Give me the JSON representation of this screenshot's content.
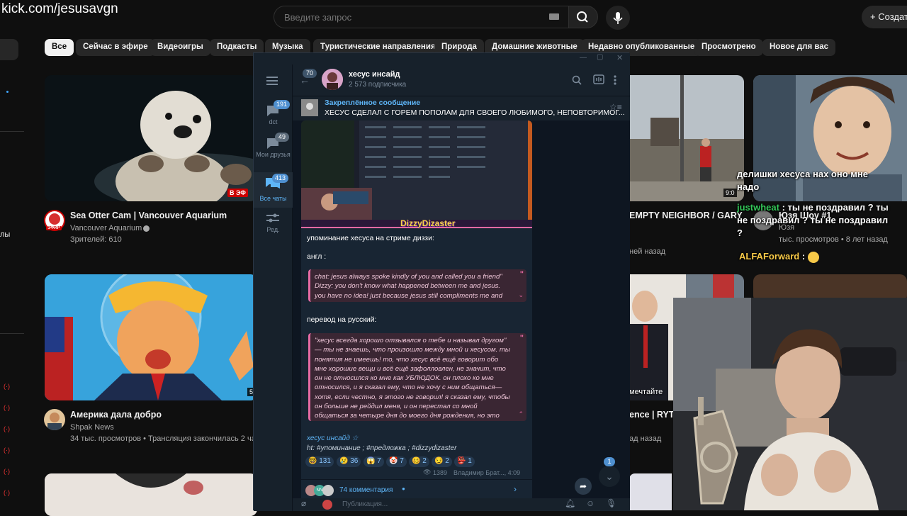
{
  "overlay": {
    "watermark": "kick.com/jesusavgn"
  },
  "youtube": {
    "search": {
      "placeholder": "Введите запрос"
    },
    "create_label": "Создать",
    "chips": [
      "Все",
      "Сейчас в эфире",
      "Видеоигры",
      "Подкасты",
      "Музыка",
      "Туристические направления",
      "Природа",
      "Домашние животные",
      "Недавно опубликованные",
      "Просмотрено",
      "Новое для вас"
    ],
    "left_partial_text": "лы",
    "videos": [
      {
        "title": "Sea Otter Cam | Vancouver Aquarium",
        "channel": "Vancouver Aquarium",
        "meta": "Зрителей: 610",
        "badge": "В ЭФ",
        "avatar_label": "ЭФИР"
      },
      {
        "title": "Америка дала добро",
        "channel": "Shpak News",
        "meta": "34 тыс. просмотров • Трансляция закончилась 2 ча",
        "duration": "5"
      },
      {
        "title": "EMPTY NEIGHBOR / GARY",
        "meta": "ней назад",
        "duration": "9:0"
      },
      {
        "title": "Юзя Шоу #1",
        "meta": "тыс. просмотров • 8 лет назад",
        "channel_partial": "Юзя"
      },
      {
        "title": "ence | RYTF",
        "meta": "ад назад",
        "overlay_text": "мечтайте"
      }
    ]
  },
  "telegram": {
    "channel_name": "хесус инсайд",
    "subscribers": "2 573 подписчика",
    "back_count": "70",
    "pinned_title": "Закреплённое сообщение",
    "pinned_text": "ХЕСУС СДЕЛАЛ С ГОРЕМ ПОПОЛАМ ДЛЯ СВОЕГО ЛЮБИМОГО, НЕПОВТОРИМОГ...",
    "folders": [
      {
        "label": "dct",
        "count": "191"
      },
      {
        "label": "Мои друзья",
        "count": "49"
      },
      {
        "label": "Все чаты",
        "count": "413"
      },
      {
        "label": "Ред.",
        "count": ""
      }
    ],
    "image_caption": "DizzyDizaster",
    "message": {
      "line1": "упоминание хесуса на стриме диззи:",
      "line2": "англ :",
      "quote_en": "chat: jesus always spoke kindly of you and called you a friend\" Dizzy: you don't know what happened between me and jesus. you have no idea! just because jesus still compliments me and still",
      "line3": "перевод на русский:",
      "quote_ru": "\"хесус всегда хорошо отзывался о тебе и называл другом\" — ты не знаешь, что произошло между мной и хесусом. ты понятия не имеешь! то, что хесус всё ещё говорит обо мне хорошие вещи и всё ещё зафолловлен, не значит, что он не относился ко мне как УБЛЮДОК. он плохо ко мне относился, и я сказал ему, что не хочу с ним общаться— хотя, если честно, я этого не говорил! я сказал ему, чтобы он больше не рейдил меня, и он перестал со мной общаться за четыре дня до моего дня рождения, но это уже другая история",
      "signature": "хесус инсайд ☆",
      "hashtags": "ht: #упоминание ; #предложка ; #dizzydizaster",
      "reactions": [
        {
          "emoji": "🤓",
          "count": "131"
        },
        {
          "emoji": "😢",
          "count": "36"
        },
        {
          "emoji": "😱",
          "count": "7"
        },
        {
          "emoji": "🤡",
          "count": "7"
        },
        {
          "emoji": "🥴",
          "count": "2"
        },
        {
          "emoji": "😏",
          "count": "2"
        },
        {
          "emoji": "👺",
          "count": "1"
        }
      ],
      "views": "1389",
      "author_time": "Владимир Брат..., 4:09",
      "comments": "74 комментария"
    },
    "unread_badge": "1",
    "compose_placeholder": "Публикация..."
  },
  "stream_chat": {
    "line_top": "делишки хесуса нах оно мне надо",
    "user1": "justwheat",
    "msg1": "ты не поздравил ? ты не поздравил ? ты не поздравил ?",
    "user2": "ALFAForward",
    "msg2": ":"
  },
  "colors": {
    "yt_bg": "#0f0f0f",
    "tg_bg": "#0e1621",
    "tg_accent": "#4f90d0",
    "quote_pink": "#e56aa3",
    "user1_color": "#34c759",
    "user2_color": "#f7c948"
  }
}
